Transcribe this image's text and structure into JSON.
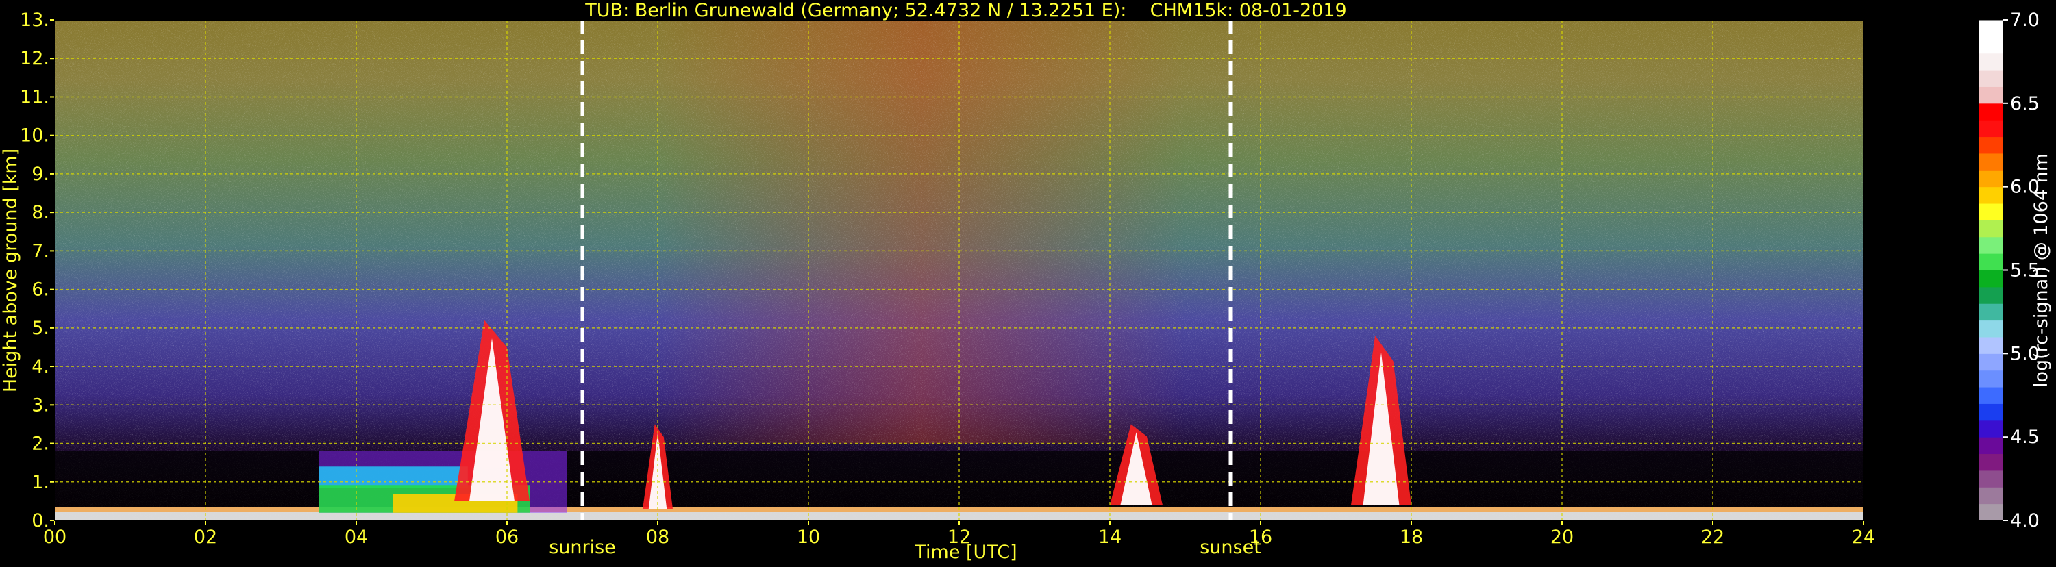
{
  "chart_data": {
    "type": "heatmap",
    "title": "TUB: Berlin Grunewald (Germany; 52.4732 N / 13.2251 E):    CHM15k: 08-01-2019",
    "xlabel": "Time [UTC]",
    "ylabel": "Height above ground [km]",
    "x_ticks": [
      "00",
      "02",
      "04",
      "06",
      "08",
      "10",
      "12",
      "14",
      "16",
      "18",
      "20",
      "22",
      "24"
    ],
    "y_ticks": [
      "0.",
      "1.",
      "2.",
      "3.",
      "4.",
      "5.",
      "6.",
      "7.",
      "8.",
      "9.",
      "10.",
      "11.",
      "12.",
      "13."
    ],
    "xlim": [
      0,
      24
    ],
    "ylim": [
      0,
      13
    ],
    "grid": true,
    "annotations": [
      {
        "label": "sunrise",
        "time": 7.0
      },
      {
        "label": "sunset",
        "time": 15.6
      }
    ],
    "colorbar": {
      "label": "log(rc-signal) @ 1064 nm",
      "range": [
        4.0,
        7.0
      ],
      "ticks": [
        "4.0",
        "4.5",
        "5.0",
        "5.5",
        "6.0",
        "6.5",
        "7.0"
      ],
      "colors": [
        "#a89aa8",
        "#9c7a9c",
        "#8e4d8e",
        "#801a80",
        "#6a0a9a",
        "#3a0fd0",
        "#1a3ef0",
        "#3d6bff",
        "#6b8fff",
        "#8ea6ff",
        "#b0c4ff",
        "#8ed8e8",
        "#40b8a0",
        "#14a050",
        "#0ab020",
        "#40e050",
        "#7af07a",
        "#b0f050",
        "#ffff20",
        "#ffd000",
        "#ffa800",
        "#ff7a00",
        "#ff4000",
        "#ff1010",
        "#ff0000",
        "#f0c0c0",
        "#f2d8d8",
        "#f8f0f0",
        "#ffffff",
        "#ffffff"
      ]
    },
    "features": [
      {
        "name": "aerosol layer",
        "t0": 0.0,
        "t1": 24.0,
        "h0": 0.0,
        "h1": 0.35
      },
      {
        "name": "boundary layer",
        "t0": 3.5,
        "t1": 6.8,
        "h0": 0.2,
        "h1": 1.8
      },
      {
        "name": "cloud",
        "t0": 5.3,
        "t1": 6.3,
        "h0": 0.5,
        "h1": 5.2
      },
      {
        "name": "cloud",
        "t0": 7.8,
        "t1": 8.2,
        "h0": 0.3,
        "h1": 2.5
      },
      {
        "name": "cloud",
        "t0": 14.0,
        "t1": 14.7,
        "h0": 0.4,
        "h1": 2.5
      },
      {
        "name": "cloud",
        "t0": 17.2,
        "t1": 18.0,
        "h0": 0.4,
        "h1": 4.8
      }
    ]
  }
}
